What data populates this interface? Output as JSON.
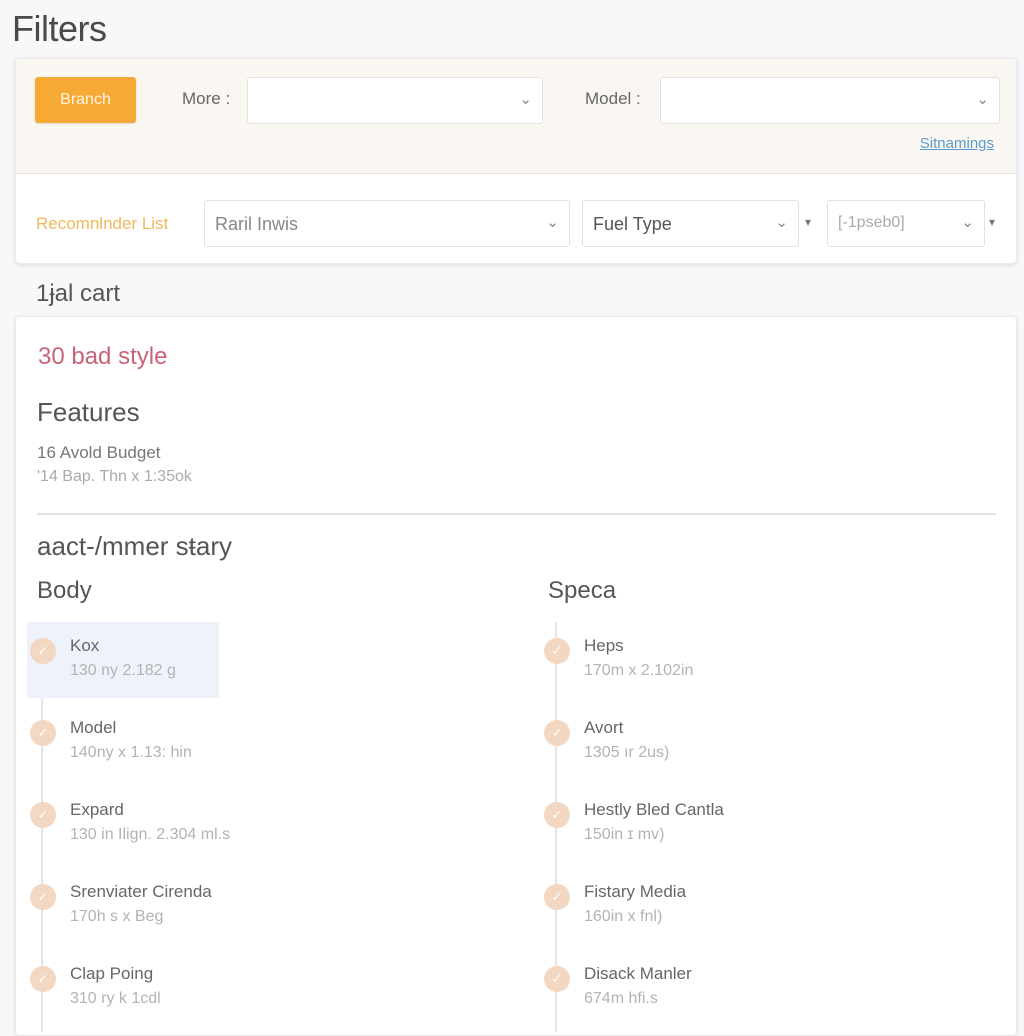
{
  "page": {
    "title": "Filters"
  },
  "filters": {
    "branch_button": "Branch",
    "more_label": "More :",
    "more_value": "",
    "model_label": "Model :",
    "model_value": "",
    "settings_link": "Sitnamings",
    "recommender_label": "Recomnlnder List",
    "recommender_value": "Raril Inwis",
    "fuel_type_value": "Fuel Type",
    "extra_select_value": "[-1pseb0]",
    "chevron_glyph": "⌄",
    "small_caret_glyph": "▾"
  },
  "results": {
    "section_title": "1ɉal cart",
    "style_title": "30 bad style",
    "features_title": "Features",
    "features_line1": "16 Avold Budget",
    "features_line2": "'14 Bap. Thn x 1:35ok",
    "summary_title": "aact-/mmer sŧary",
    "accent_color": "#f7a935",
    "body_column": {
      "title": "Body",
      "items": [
        {
          "name": "Kox",
          "meta": "130 ny 2.182 g",
          "active": true
        },
        {
          "name": "Model",
          "meta": "140ny x 1.13: hin",
          "active": false
        },
        {
          "name": "Expard",
          "meta": "130 in Ilign. 2.304 ml.s",
          "active": false
        },
        {
          "name": "Srenviater Cirenda",
          "meta": "170h s x Beg",
          "active": false
        },
        {
          "name": "Clap Poing",
          "meta": "310 ry k 1cdl",
          "active": false
        }
      ]
    },
    "specs_column": {
      "title": "Speca",
      "items": [
        {
          "name": "Heps",
          "meta": "170m x 2.102in",
          "active": false
        },
        {
          "name": "Avort",
          "meta": "1305 ır 2us)",
          "active": false
        },
        {
          "name": "Hestly Bled Cantla",
          "meta": "150in ɪ mv)",
          "active": false
        },
        {
          "name": "Fistary Media",
          "meta": "160in x fnl)",
          "active": false
        },
        {
          "name": "Disack Manler",
          "meta": "674m hfi.s",
          "active": false
        }
      ]
    },
    "check_glyph": "✓"
  }
}
